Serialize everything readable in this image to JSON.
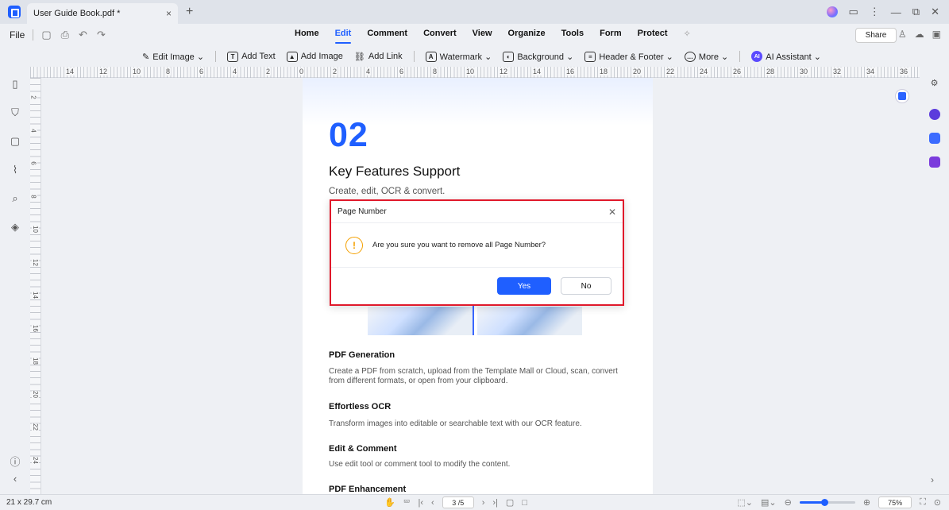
{
  "titlebar": {
    "tab_title": "User Guide Book.pdf *",
    "tab_close": "×",
    "new_tab": "+",
    "controls": [
      "⋮",
      "—",
      "⧉",
      "✕"
    ]
  },
  "menubar": {
    "file": "File",
    "tabs": [
      {
        "label": "Home",
        "active": false
      },
      {
        "label": "Edit",
        "active": true
      },
      {
        "label": "Comment",
        "active": false
      },
      {
        "label": "Convert",
        "active": false
      },
      {
        "label": "View",
        "active": false
      },
      {
        "label": "Organize",
        "active": false
      },
      {
        "label": "Tools",
        "active": false
      },
      {
        "label": "Form",
        "active": false
      },
      {
        "label": "Protect",
        "active": false
      }
    ],
    "share": "Share"
  },
  "toolbar": {
    "edit_image": "Edit Image ⌄",
    "add_text": "Add Text",
    "add_image": "Add Image",
    "add_link": "Add Link",
    "watermark": "Watermark ⌄",
    "background": "Background ⌄",
    "header_footer": "Header & Footer ⌄",
    "more": "More ⌄",
    "ai_assistant": "AI Assistant ⌄"
  },
  "ruler": {
    "labels": [
      "14",
      "12",
      "10",
      "8",
      "6",
      "4",
      "2",
      "0",
      "2",
      "4",
      "6",
      "8",
      "10",
      "12",
      "14",
      "16",
      "18",
      "20",
      "22",
      "24",
      "26",
      "28",
      "30",
      "32",
      "34",
      "36"
    ]
  },
  "vruler": {
    "labels": [
      "2",
      "4",
      "6",
      "8",
      "10",
      "12",
      "14",
      "16",
      "18",
      "20",
      "22",
      "24"
    ]
  },
  "document": {
    "number": "02",
    "heading": "Key Features Support",
    "subheading": "Create, edit, OCR & convert.",
    "features": [
      {
        "title": "PDF Generation",
        "text": "Create a PDF from scratch, upload from the Template Mall or Cloud, scan, convert from different formats, or open from your clipboard."
      },
      {
        "title": "Effortless OCR",
        "text": "Transform images into editable or searchable text with our OCR feature."
      },
      {
        "title": "Edit & Comment",
        "text": "Use edit tool or comment tool to modify the content."
      },
      {
        "title": "PDF Enhancement",
        "text": ""
      }
    ]
  },
  "dialog": {
    "title": "Page Number",
    "message": "Are you sure you want to remove all Page Number?",
    "yes": "Yes",
    "no": "No"
  },
  "statusbar": {
    "page_size": "21 x 29.7 cm",
    "page_indicator": "3 /5",
    "zoom": "75%",
    "zoom_level": 0.45
  },
  "colors": {
    "accent": "#1f5fff",
    "dialog_border": "#e0192b",
    "warning": "#f4a000"
  }
}
